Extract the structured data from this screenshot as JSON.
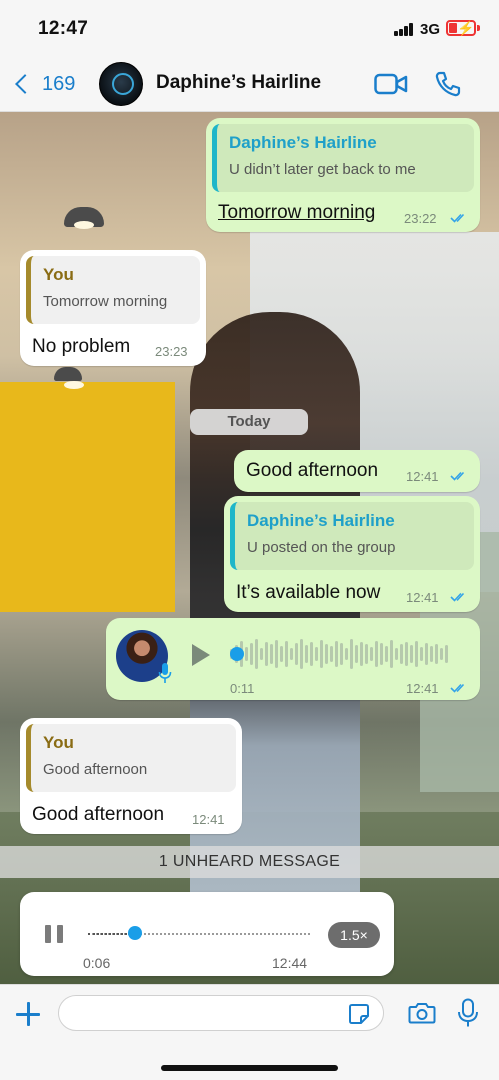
{
  "status_bar": {
    "time": "12:47",
    "network": "3G"
  },
  "header": {
    "back_count": "169",
    "contact_name": "Daphine’s Hairline"
  },
  "messages": [
    {
      "type": "out",
      "quote_name": "Daphine’s Hairline",
      "quote_text": "U didn’t later get back to me",
      "text": "Tomorrow morning",
      "time": "23:22"
    },
    {
      "type": "in",
      "quote_name": "You",
      "quote_text": "Tomorrow morning",
      "text": "No problem",
      "time": "23:23"
    },
    {
      "type": "date",
      "text": "Today"
    },
    {
      "type": "out",
      "text": "Good afternoon",
      "time": "12:41"
    },
    {
      "type": "out",
      "quote_name": "Daphine’s Hairline",
      "quote_text": "U posted on the group",
      "text": "It’s available now",
      "time": "12:41"
    },
    {
      "type": "voice",
      "duration": "0:11",
      "time": "12:41"
    },
    {
      "type": "in",
      "quote_name": "You",
      "quote_text": "Good afternoon",
      "text": "Good afternoon",
      "time": "12:41"
    }
  ],
  "unheard_banner": "1 UNHEARD MESSAGE",
  "player": {
    "elapsed": "0:06",
    "total": "12:44",
    "speed": "1.5×",
    "progress": 0.21
  },
  "composer": {
    "placeholder": ""
  },
  "colors": {
    "accent": "#1a7ecb",
    "outgoing_bubble": "#dcf8c6",
    "incoming_bubble": "#ffffff",
    "read_ticks": "#34a4e8",
    "quote_bar_out": "#1fb6c9",
    "quote_bar_in": "#a58a2c"
  },
  "icons": [
    "back-chevron-icon",
    "video-call-icon",
    "phone-icon",
    "double-check-icon",
    "play-icon",
    "microphone-icon",
    "pause-icon",
    "plus-icon",
    "sticker-icon",
    "camera-icon"
  ]
}
